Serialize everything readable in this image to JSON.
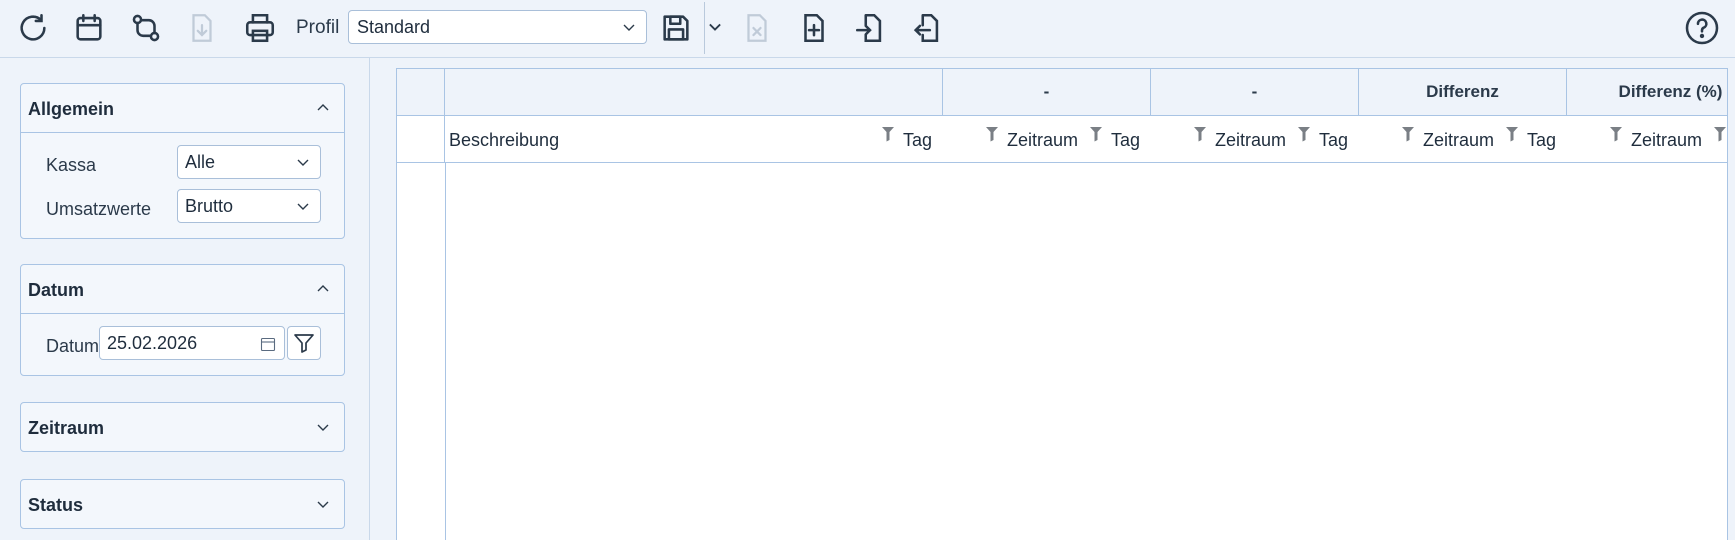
{
  "toolbar": {
    "buttons": [
      {
        "name": "refresh-icon"
      },
      {
        "name": "calendar-icon"
      },
      {
        "name": "compare-icon"
      },
      {
        "name": "download-icon"
      },
      {
        "name": "print-icon"
      }
    ],
    "profil_label": "Profil",
    "profil_value": "Standard",
    "right_buttons": [
      {
        "name": "save-icon"
      },
      {
        "name": "delete-file-icon"
      },
      {
        "name": "new-file-icon"
      },
      {
        "name": "import-icon"
      },
      {
        "name": "export-icon"
      }
    ],
    "help": "help-icon"
  },
  "panel": {
    "allgemein": {
      "title": "Allgemein",
      "kassa_label": "Kassa",
      "kassa_value": "Alle",
      "umsatz_label": "Umsatzwerte",
      "umsatz_value": "Brutto"
    },
    "datum": {
      "title": "Datum",
      "datum_label": "Datum",
      "datum_value": "25.02.2026"
    },
    "zeitraum": {
      "title": "Zeitraum"
    },
    "status": {
      "title": "Status"
    }
  },
  "grid": {
    "groups": [
      "",
      "-",
      "-",
      "Differenz",
      "Differenz (%)"
    ],
    "columns": [
      "Beschreibung",
      "Tag",
      "Zeitraum",
      "Tag",
      "Zeitraum",
      "Tag",
      "Zeitraum",
      "Tag",
      "Zeitraum"
    ]
  },
  "colors": {
    "accent": "#2b3a4a",
    "border": "#a9c4e4",
    "background": "#eef3fa"
  }
}
